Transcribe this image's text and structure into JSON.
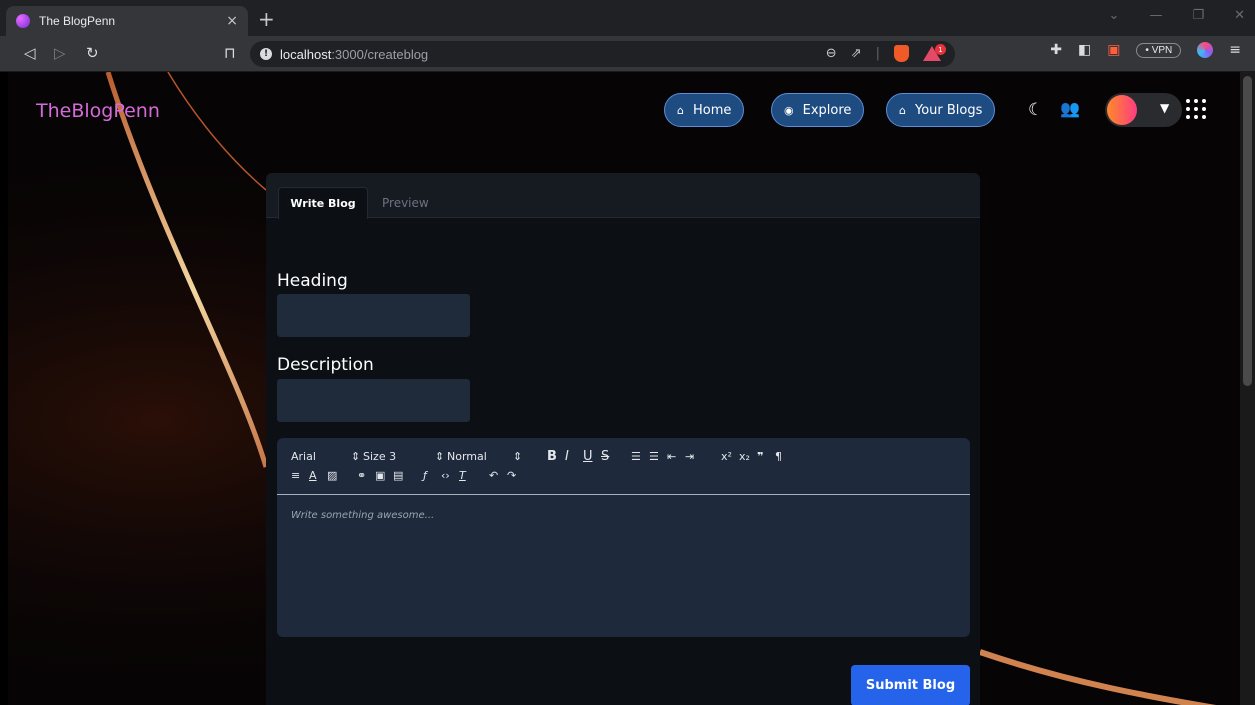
{
  "browser": {
    "tab_title": "The BlogPenn",
    "tab_close": "×",
    "new_tab": "+",
    "url_host": "localhost",
    "url_path": ":3000/createblog",
    "info_icon": "!",
    "brave_badge": "1",
    "vpn_label": "• VPN"
  },
  "header": {
    "brand": "TheBlogPenn",
    "nav": [
      {
        "label": "Home",
        "icon": "home-icon"
      },
      {
        "label": "Explore",
        "icon": "compass-icon"
      },
      {
        "label": "Your Blogs",
        "icon": "home-icon"
      }
    ]
  },
  "editor_card": {
    "tabs": {
      "write": "Write Blog",
      "preview": "Preview"
    },
    "heading_label": "Heading",
    "description_label": "Description",
    "toolbar": {
      "font": "Arial",
      "size": "Size 3",
      "style": "Normal"
    },
    "placeholder": "Write something awesome...",
    "submit_label": "Submit Blog"
  },
  "colors": {
    "brand": "#d56bd8",
    "nav_pill": "#1e4b80",
    "submit": "#2563eb",
    "card": "#0c0f14",
    "input": "#1f2a3b"
  }
}
